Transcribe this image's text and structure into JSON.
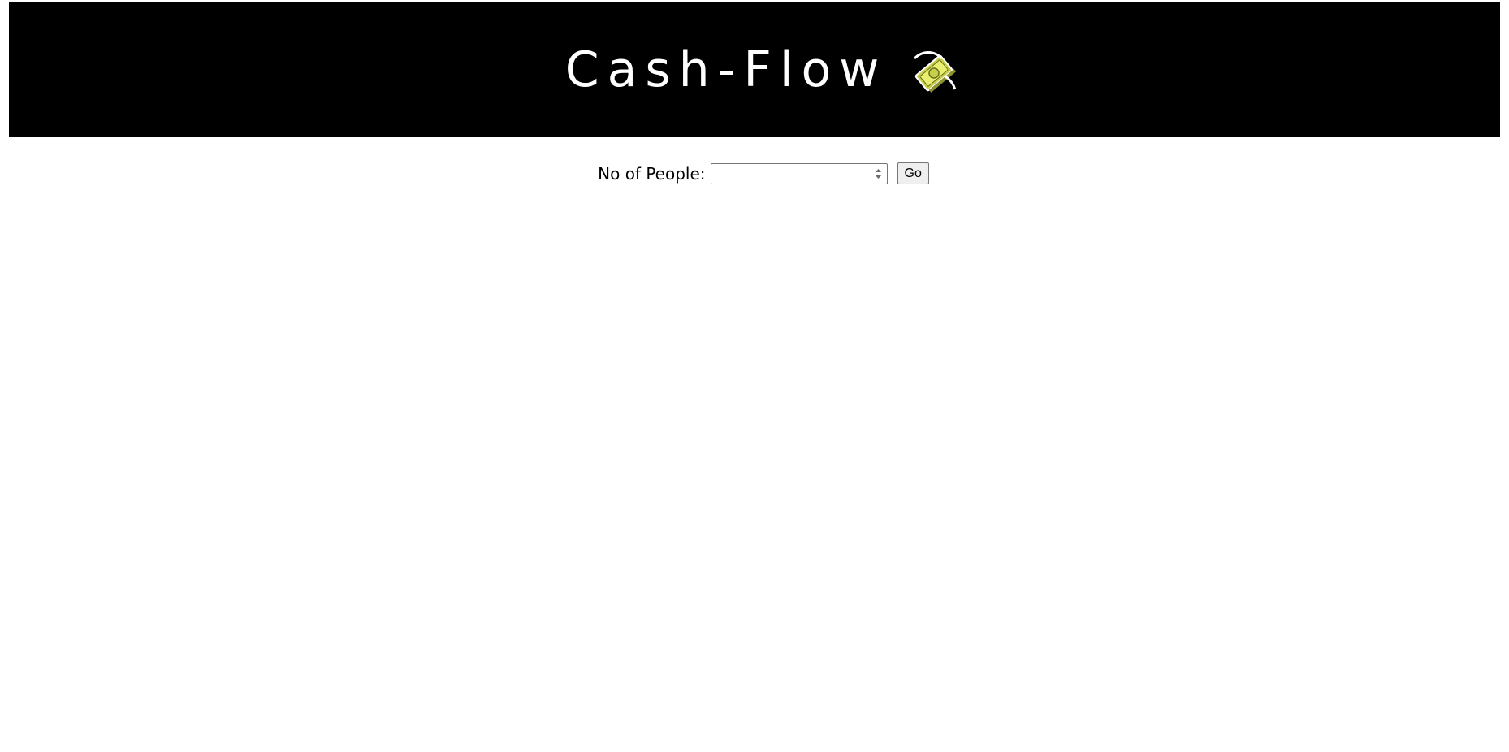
{
  "header": {
    "title": "Cash-Flow",
    "logo_icon": "money-bill-icon",
    "background": "#000000",
    "title_color": "#ffffff"
  },
  "form": {
    "people_label": "No of People:",
    "people_value": "",
    "people_placeholder": "",
    "go_label": "Go"
  }
}
